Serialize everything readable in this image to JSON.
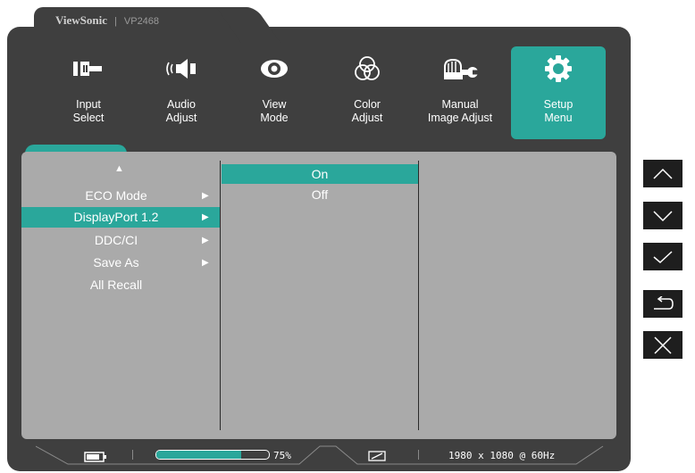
{
  "header": {
    "brand": "ViewSonic",
    "separator": "|",
    "model": "VP2468"
  },
  "menu": [
    {
      "label": "Input\nSelect",
      "icon": "input-select-icon",
      "active": false
    },
    {
      "label": "Audio\nAdjust",
      "icon": "speaker-icon",
      "active": false
    },
    {
      "label": "View\nMode",
      "icon": "eye-icon",
      "active": false
    },
    {
      "label": "Color\nAdjust",
      "icon": "color-circles-icon",
      "active": false
    },
    {
      "label": "Manual\nImage Adjust",
      "icon": "hand-wrench-icon",
      "active": false
    },
    {
      "label": "Setup\nMenu",
      "icon": "gear-icon",
      "active": true
    }
  ],
  "submenu": {
    "scroll_up": "▲",
    "items": [
      {
        "label": "ECO Mode",
        "arrow": "▶"
      },
      {
        "label": "DisplayPort 1.2",
        "arrow": "▶",
        "selected": true
      },
      {
        "label": "DDC/CI",
        "arrow": "▶"
      },
      {
        "label": "Save As",
        "arrow": "▶"
      },
      {
        "label": "All Recall",
        "arrow": ""
      }
    ]
  },
  "options": [
    {
      "label": "On",
      "selected": true
    },
    {
      "label": "Off",
      "selected": false
    }
  ],
  "status": {
    "brightness_percent": 75,
    "brightness_label": "75%",
    "resolution": "1980 x 1080 @ 60Hz"
  },
  "side_buttons": [
    "up-button",
    "down-button",
    "confirm-button",
    "return-button",
    "close-button"
  ],
  "colors": {
    "accent": "#2aa79b",
    "frame": "#3f3f3f",
    "panel": "#aaaaaa"
  }
}
